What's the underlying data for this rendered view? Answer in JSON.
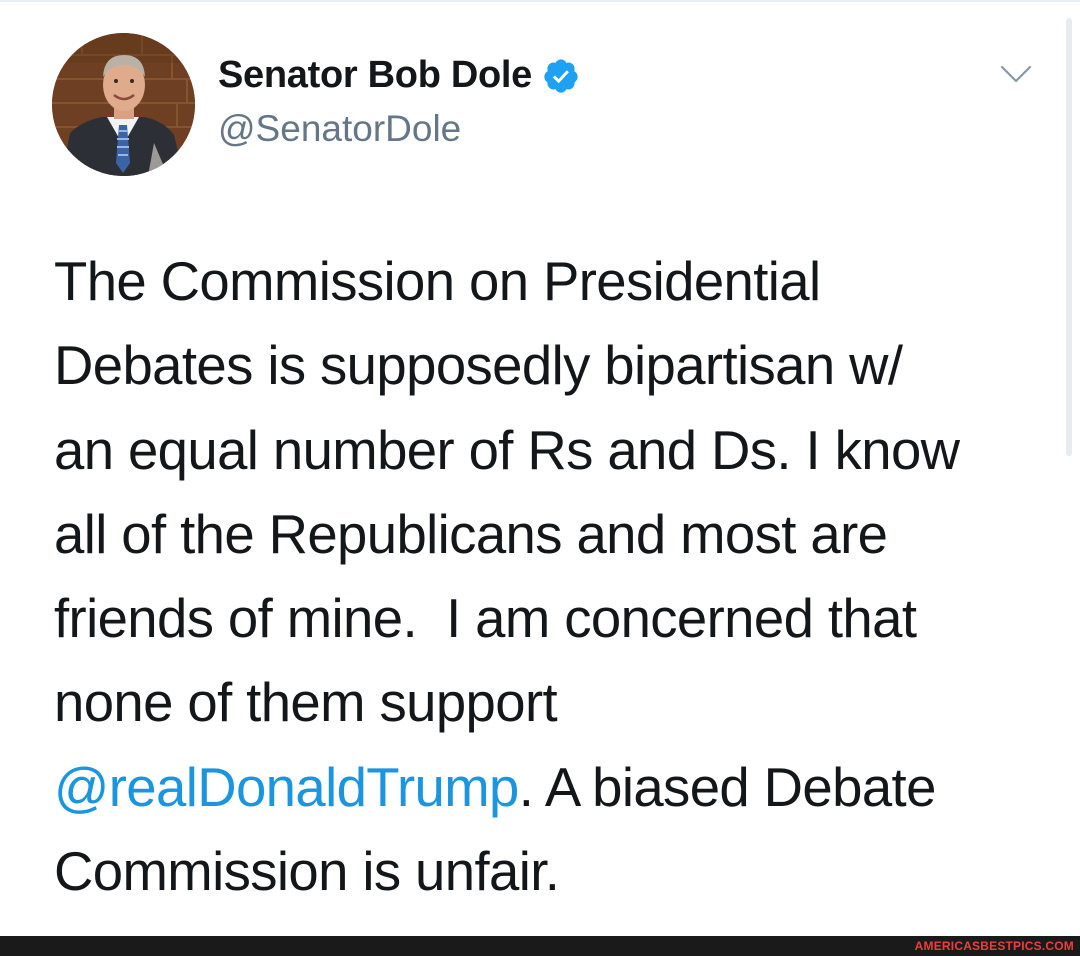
{
  "author": {
    "display_name": "Senator Bob Dole",
    "handle": "@SenatorDole",
    "verified": true
  },
  "icons": {
    "verified": "verified-badge-icon",
    "menu": "chevron-down-icon"
  },
  "tweet": {
    "text_line1": "The Commission on Presidential",
    "text_line2": "Debates is supposedly bipartisan w/",
    "text_line3": "an equal number of Rs and Ds. I know",
    "text_line4": "all of the Republicans and most are",
    "text_line5": "friends of mine.  I am concerned that",
    "text_line6": "none of them support",
    "mention": "@realDonaldTrump",
    "text_after_mention": ". A biased Debate",
    "text_line8": "Commission is unfair."
  },
  "watermark": "AMERICASBESTPICS.COM",
  "colors": {
    "text": "#14171a",
    "handle": "#657786",
    "link": "#1b95e0",
    "verified": "#1da1f2",
    "footer": "#1a1a1a",
    "watermark": "#f03c3c"
  }
}
